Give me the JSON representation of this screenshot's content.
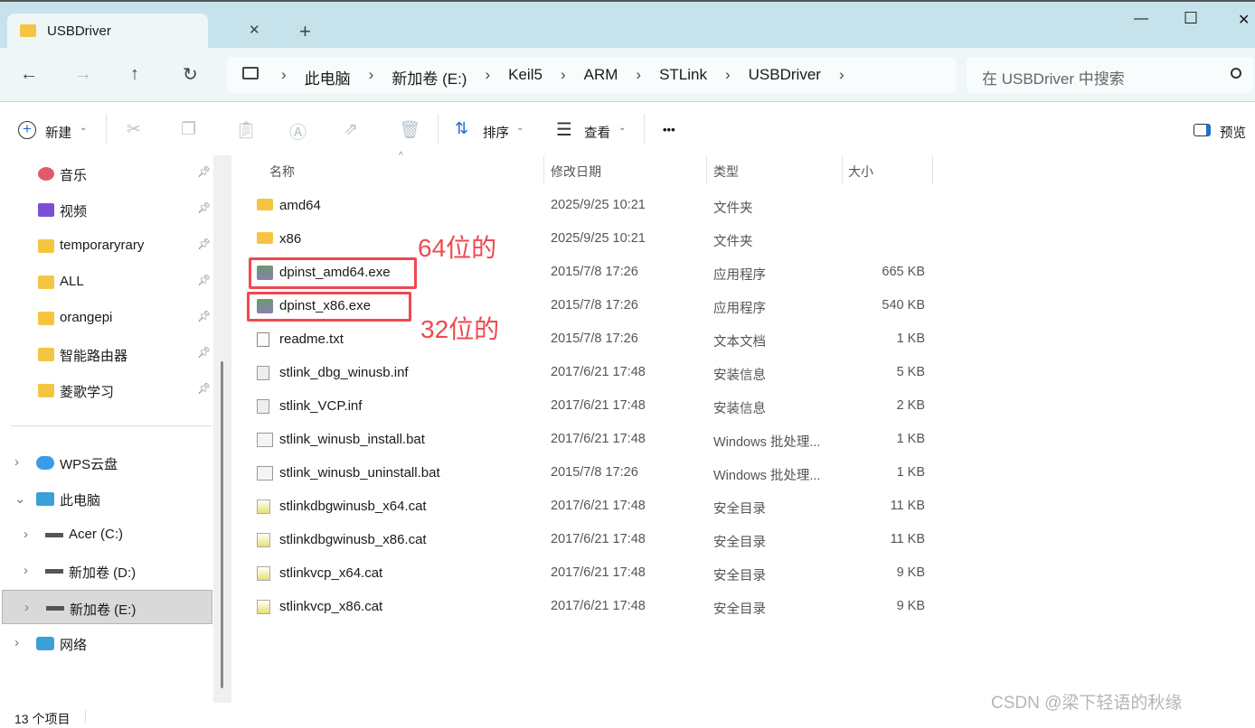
{
  "window": {
    "tab_title": "USBDriver",
    "new_tab": "+",
    "minimize": "—",
    "maximize": "☐",
    "close": "✕"
  },
  "nav": {
    "back": "←",
    "forward": "→",
    "up": "↑",
    "refresh": "↻",
    "breadcrumb": [
      "此电脑",
      "新加卷 (E:)",
      "Keil5",
      "ARM",
      "STLink",
      "USBDriver"
    ],
    "search_placeholder": "在 USBDriver 中搜索"
  },
  "toolbar": {
    "new": "新建",
    "sort": "排序",
    "view": "查看",
    "more": "•••",
    "preview": "预览"
  },
  "sidebar": {
    "pinned": [
      "音乐",
      "视频",
      "temporaryrary",
      "ALL",
      "orangepi",
      "智能路由器",
      "菱歌学习"
    ],
    "tree": [
      {
        "label": "WPS云盘",
        "indent": 0,
        "icon": "cloud"
      },
      {
        "label": "此电脑",
        "indent": 0,
        "icon": "pc",
        "expanded": true
      },
      {
        "label": "Acer (C:)",
        "indent": 1,
        "icon": "drive-c"
      },
      {
        "label": "新加卷 (D:)",
        "indent": 1,
        "icon": "drive"
      },
      {
        "label": "新加卷 (E:)",
        "indent": 1,
        "icon": "drive",
        "selected": true
      },
      {
        "label": "网络",
        "indent": 0,
        "icon": "network"
      }
    ]
  },
  "columns": {
    "name": "名称",
    "date": "修改日期",
    "type": "类型",
    "size": "大小"
  },
  "files": [
    {
      "name": "amd64",
      "date": "2025/9/25 10:21",
      "type": "文件夹",
      "size": "",
      "icon": "folder"
    },
    {
      "name": "x86",
      "date": "2025/9/25 10:21",
      "type": "文件夹",
      "size": "",
      "icon": "folder"
    },
    {
      "name": "dpinst_amd64.exe",
      "date": "2015/7/8 17:26",
      "type": "应用程序",
      "size": "665 KB",
      "icon": "exe"
    },
    {
      "name": "dpinst_x86.exe",
      "date": "2015/7/8 17:26",
      "type": "应用程序",
      "size": "540 KB",
      "icon": "exe"
    },
    {
      "name": "readme.txt",
      "date": "2015/7/8 17:26",
      "type": "文本文档",
      "size": "1 KB",
      "icon": "txt"
    },
    {
      "name": "stlink_dbg_winusb.inf",
      "date": "2017/6/21 17:48",
      "type": "安装信息",
      "size": "5 KB",
      "icon": "inf"
    },
    {
      "name": "stlink_VCP.inf",
      "date": "2017/6/21 17:48",
      "type": "安装信息",
      "size": "2 KB",
      "icon": "inf"
    },
    {
      "name": "stlink_winusb_install.bat",
      "date": "2017/6/21 17:48",
      "type": "Windows 批处理...",
      "size": "1 KB",
      "icon": "bat"
    },
    {
      "name": "stlink_winusb_uninstall.bat",
      "date": "2015/7/8 17:26",
      "type": "Windows 批处理...",
      "size": "1 KB",
      "icon": "bat"
    },
    {
      "name": "stlinkdbgwinusb_x64.cat",
      "date": "2017/6/21 17:48",
      "type": "安全目录",
      "size": "11 KB",
      "icon": "cat"
    },
    {
      "name": "stlinkdbgwinusb_x86.cat",
      "date": "2017/6/21 17:48",
      "type": "安全目录",
      "size": "11 KB",
      "icon": "cat"
    },
    {
      "name": "stlinkvcp_x64.cat",
      "date": "2017/6/21 17:48",
      "type": "安全目录",
      "size": "9 KB",
      "icon": "cat"
    },
    {
      "name": "stlinkvcp_x86.cat",
      "date": "2017/6/21 17:48",
      "type": "安全目录",
      "size": "9 KB",
      "icon": "cat"
    }
  ],
  "annotations": {
    "label_64": "64位的",
    "label_32": "32位的",
    "color": "#f0494f"
  },
  "status": {
    "count": "13 个项目"
  },
  "watermark": "CSDN @梁下轻语的秋缘"
}
